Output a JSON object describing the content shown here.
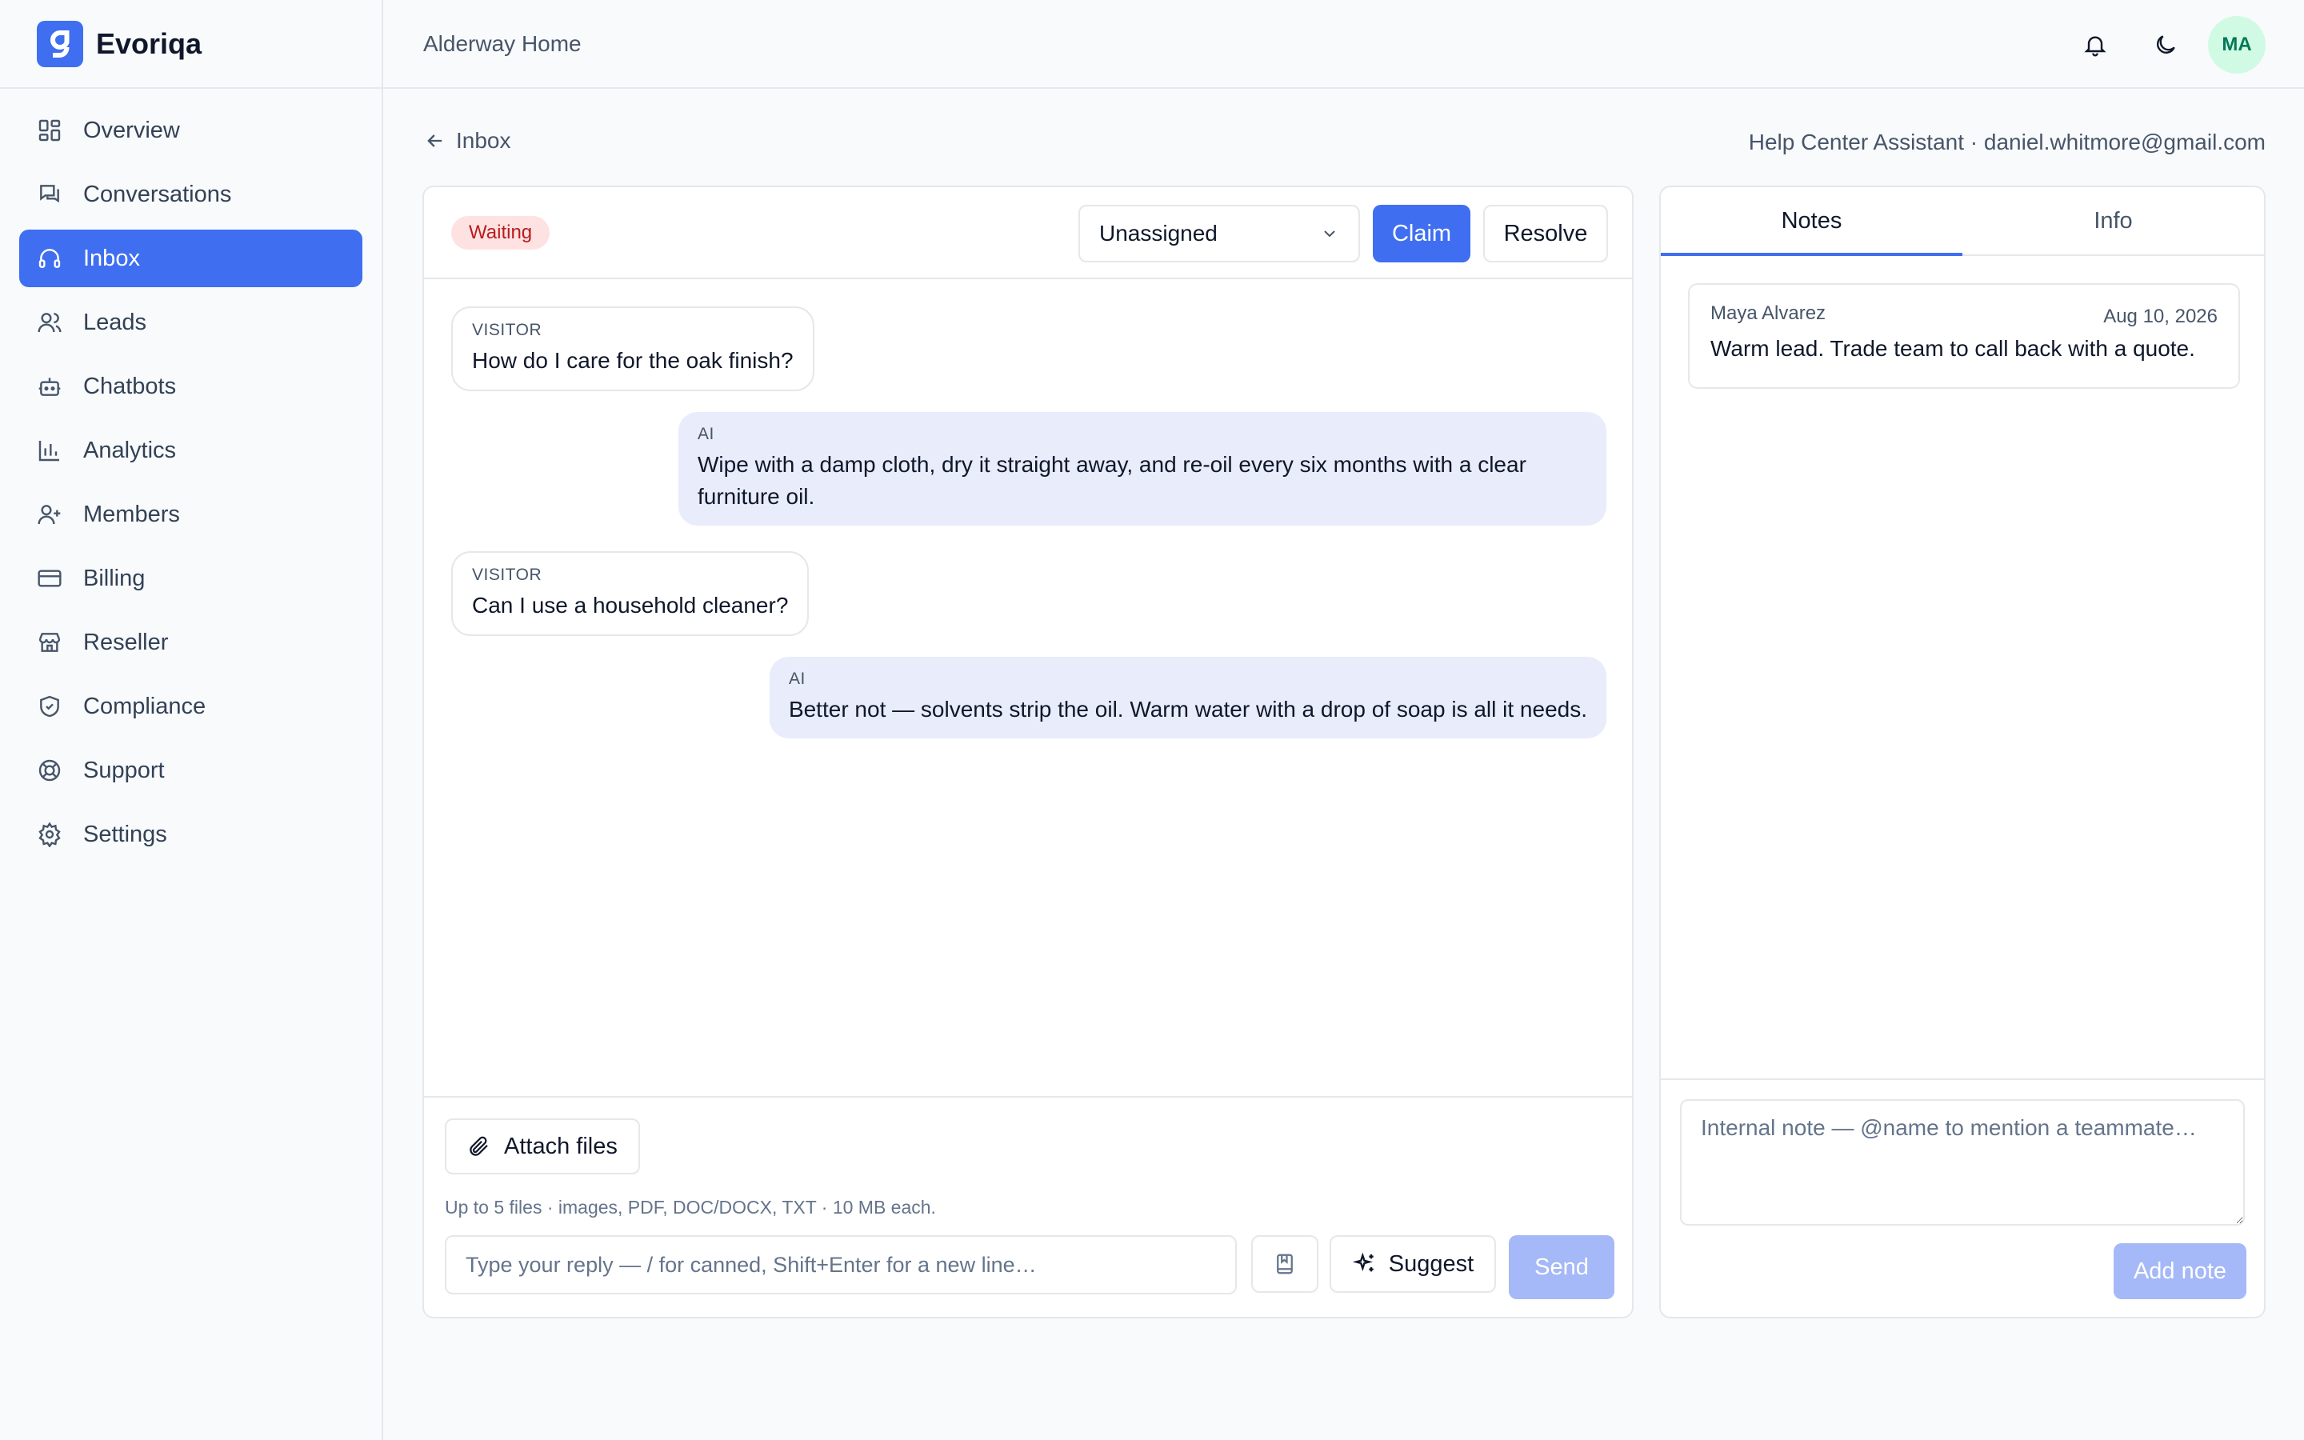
{
  "brand": {
    "name": "Evoriqa",
    "logo_icon": "brand-g-icon"
  },
  "sidebar": {
    "items": [
      {
        "label": "Overview",
        "icon": "dashboard-icon",
        "active": false
      },
      {
        "label": "Conversations",
        "icon": "chat-icon",
        "active": false
      },
      {
        "label": "Inbox",
        "icon": "headset-icon",
        "active": true
      },
      {
        "label": "Leads",
        "icon": "users-icon",
        "active": false
      },
      {
        "label": "Chatbots",
        "icon": "bot-icon",
        "active": false
      },
      {
        "label": "Analytics",
        "icon": "bar-chart-icon",
        "active": false
      },
      {
        "label": "Members",
        "icon": "user-plus-icon",
        "active": false
      },
      {
        "label": "Billing",
        "icon": "credit-card-icon",
        "active": false
      },
      {
        "label": "Reseller",
        "icon": "store-icon",
        "active": false
      },
      {
        "label": "Compliance",
        "icon": "shield-check-icon",
        "active": false
      },
      {
        "label": "Support",
        "icon": "lifebuoy-icon",
        "active": false
      },
      {
        "label": "Settings",
        "icon": "gear-icon",
        "active": false
      }
    ]
  },
  "topbar": {
    "workspace": "Alderway Home",
    "avatar_initials": "MA"
  },
  "subheader": {
    "back_label": "Inbox",
    "meta": "Help Center Assistant · daniel.whitmore@gmail.com"
  },
  "conversation": {
    "status": "Waiting",
    "assignee": "Unassigned",
    "claim_label": "Claim",
    "resolve_label": "Resolve",
    "messages": [
      {
        "role": "VISITOR",
        "text": "How do I care for the oak finish?"
      },
      {
        "role": "AI",
        "text": "Wipe with a damp cloth, dry it straight away, and re-oil every six months with a clear furniture oil."
      },
      {
        "role": "VISITOR",
        "text": "Can I use a household cleaner?"
      },
      {
        "role": "AI",
        "text": "Better not — solvents strip the oil. Warm water with a drop of soap is all it needs."
      }
    ]
  },
  "composer": {
    "attach_label": "Attach files",
    "attach_hint": "Up to 5 files · images, PDF, DOC/DOCX, TXT · 10 MB each.",
    "reply_placeholder": "Type your reply — / for canned, Shift+Enter for a new line…",
    "suggest_label": "Suggest",
    "send_label": "Send"
  },
  "side_panel": {
    "tabs": [
      {
        "label": "Notes",
        "active": true
      },
      {
        "label": "Info",
        "active": false
      }
    ],
    "notes": [
      {
        "author": "Maya Alvarez",
        "date": "Aug 10, 2026",
        "text": "Warm lead. Trade team to call back with a quote."
      }
    ],
    "note_placeholder": "Internal note — @name to mention a teammate…",
    "add_note_label": "Add note"
  },
  "colors": {
    "accent": "#3f6ff0",
    "accent_disabled": "#a5b8f7",
    "waiting_bg": "#fee2e2",
    "waiting_text": "#b91c1c",
    "ai_bubble": "#e8ecfb",
    "avatar_bg": "#d1fae5",
    "avatar_text": "#047857"
  }
}
